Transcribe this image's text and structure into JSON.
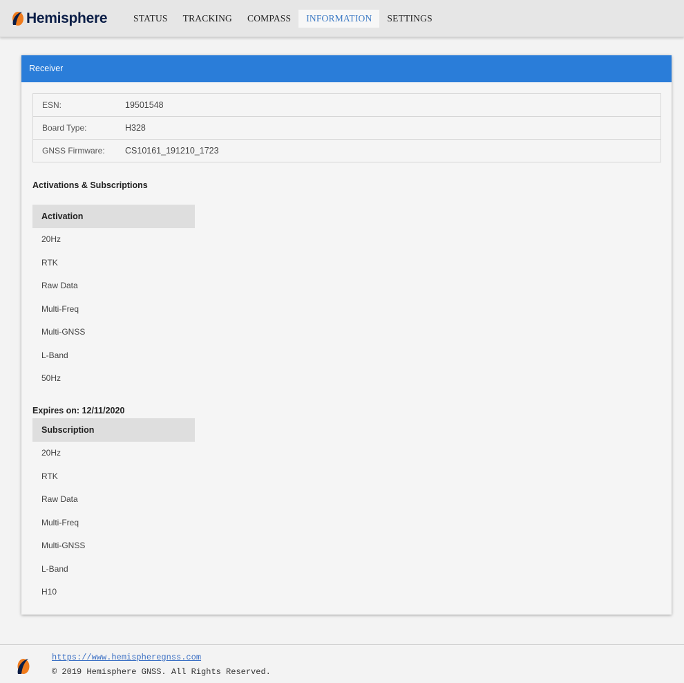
{
  "brand": {
    "name": "Hemisphere",
    "logo_icon": "hemisphere-logo-icon",
    "accent": "#f07b1c",
    "navy": "#0b1e47"
  },
  "nav": {
    "items": [
      {
        "label": "STATUS",
        "active": false
      },
      {
        "label": "TRACKING",
        "active": false
      },
      {
        "label": "COMPASS",
        "active": false
      },
      {
        "label": "INFORMATION",
        "active": true
      },
      {
        "label": "SETTINGS",
        "active": false
      }
    ]
  },
  "receiver": {
    "header": "Receiver",
    "header_color": "#2a7dd9",
    "rows": [
      {
        "label": "ESN:",
        "value": "19501548"
      },
      {
        "label": "Board Type:",
        "value": "H328"
      },
      {
        "label": "GNSS Firmware:",
        "value": "CS10161_191210_1723"
      }
    ]
  },
  "activations": {
    "section_title": "Activations & Subscriptions",
    "header": "Activation",
    "items": [
      "20Hz",
      "RTK",
      "Raw Data",
      "Multi-Freq",
      "Multi-GNSS",
      "L-Band",
      "50Hz"
    ]
  },
  "subscriptions": {
    "expires": "Expires on: 12/11/2020",
    "header": "Subscription",
    "items": [
      "20Hz",
      "RTK",
      "Raw Data",
      "Multi-Freq",
      "Multi-GNSS",
      "L-Band",
      "H10"
    ]
  },
  "footer": {
    "link": "https://www.hemispheregnss.com",
    "copyright": "© 2019 Hemisphere GNSS. All Rights Reserved."
  }
}
